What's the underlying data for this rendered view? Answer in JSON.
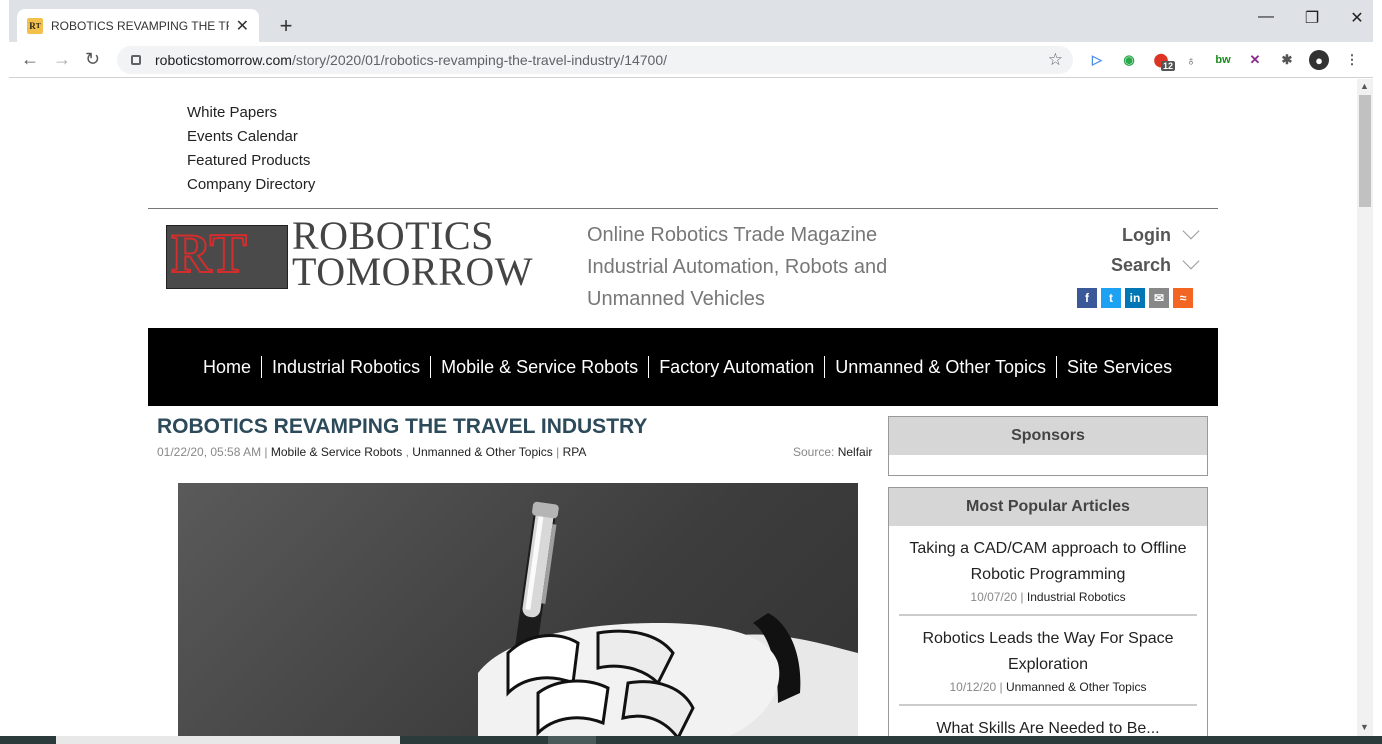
{
  "browser": {
    "tab_title": "ROBOTICS REVAMPING THE TRA",
    "tab_close": "✕",
    "new_tab": "+",
    "url_domain": "roboticstomorrow.com",
    "url_path": "/story/2020/01/robotics-revamping-the-travel-industry/14700/",
    "extension_badge": "12",
    "controls": {
      "minimize": "—",
      "restore": "❐",
      "close": "✕"
    }
  },
  "top_links": [
    "White Papers",
    "Events Calendar",
    "Featured Products",
    "Company Directory"
  ],
  "logo": {
    "line1": "ROBOTICS",
    "line2": "TOMORROW",
    "mark": "RT"
  },
  "tagline": "Online Robotics Trade Magazine Industrial Automation, Robots and Unmanned Vehicles",
  "account": {
    "login": "Login",
    "search": "Search"
  },
  "social": {
    "facebook": "f",
    "twitter": "t",
    "linkedin": "in",
    "email": "✉",
    "rss": "≈"
  },
  "nav": [
    "Home",
    "Industrial Robotics",
    "Mobile & Service Robots",
    "Factory Automation",
    "Unmanned & Other Topics",
    "Site Services"
  ],
  "article": {
    "title": "ROBOTICS REVAMPING THE TRAVEL INDUSTRY",
    "date": "01/22/20, 05:58 AM | ",
    "cat1": "Mobile & Service Robots",
    "sep1": " , ",
    "cat2": "Unmanned & Other Topics",
    "sep2": " | ",
    "cat3": "RPA",
    "source_label": "Source: ",
    "source": "Nelfair"
  },
  "sidebar": {
    "sponsors_title": "Sponsors",
    "popular_title": "Most Popular Articles",
    "popular": [
      {
        "title": "Taking a CAD/CAM approach to Offline Robotic Programming",
        "date": "10/07/20 | ",
        "category": "Industrial Robotics"
      },
      {
        "title": "Robotics Leads the Way For Space Exploration",
        "date": "10/12/20 | ",
        "category": "Unmanned & Other Topics"
      },
      {
        "title": "What Skills Are Needed to Be...",
        "date": "",
        "category": ""
      }
    ]
  },
  "colors": {
    "nav_bg": "#000000",
    "title": "#2d4a5a",
    "widget_head": "#d6d6d6"
  }
}
